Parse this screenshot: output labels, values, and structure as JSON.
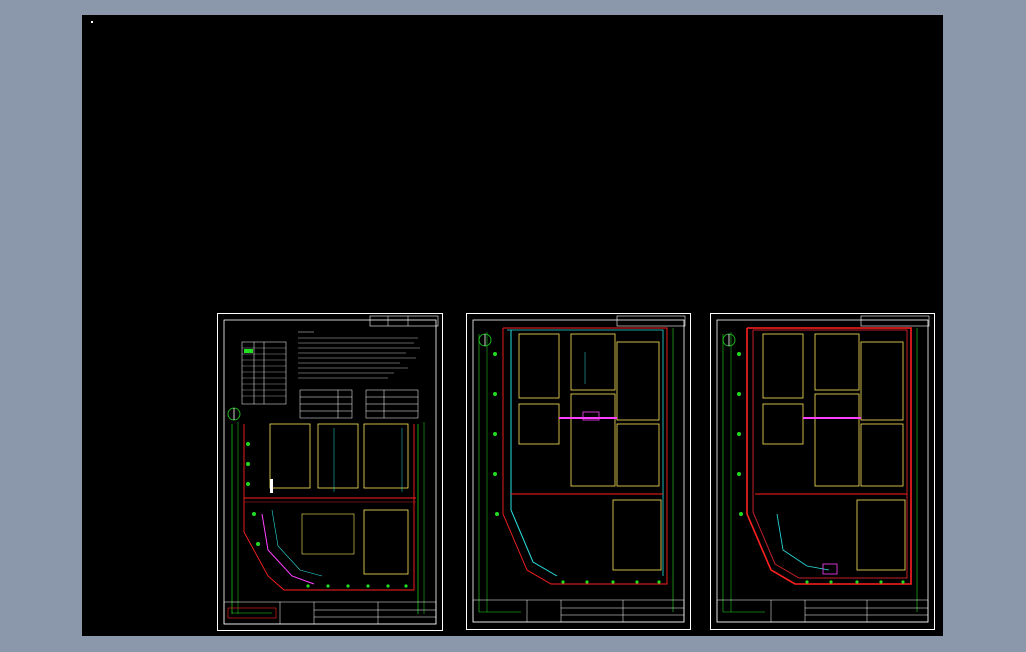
{
  "app": {
    "viewport_label": "",
    "background_color": "#8b97ab",
    "canvas_color": "#000000"
  },
  "sheets": [
    {
      "id": "sheet-1",
      "title": ""
    },
    {
      "id": "sheet-2",
      "title": ""
    },
    {
      "id": "sheet-3",
      "title": ""
    }
  ],
  "colors": {
    "frame": "#ffffff",
    "boundary": "#ff2020",
    "building": "#ffe65c",
    "green_line": "#22dd22",
    "cyan": "#28e0e0",
    "magenta": "#ff40ff",
    "dark_red": "#c0202a",
    "blue": "#4060ff"
  },
  "icons": {
    "north_arrow": "north-arrow-icon"
  }
}
